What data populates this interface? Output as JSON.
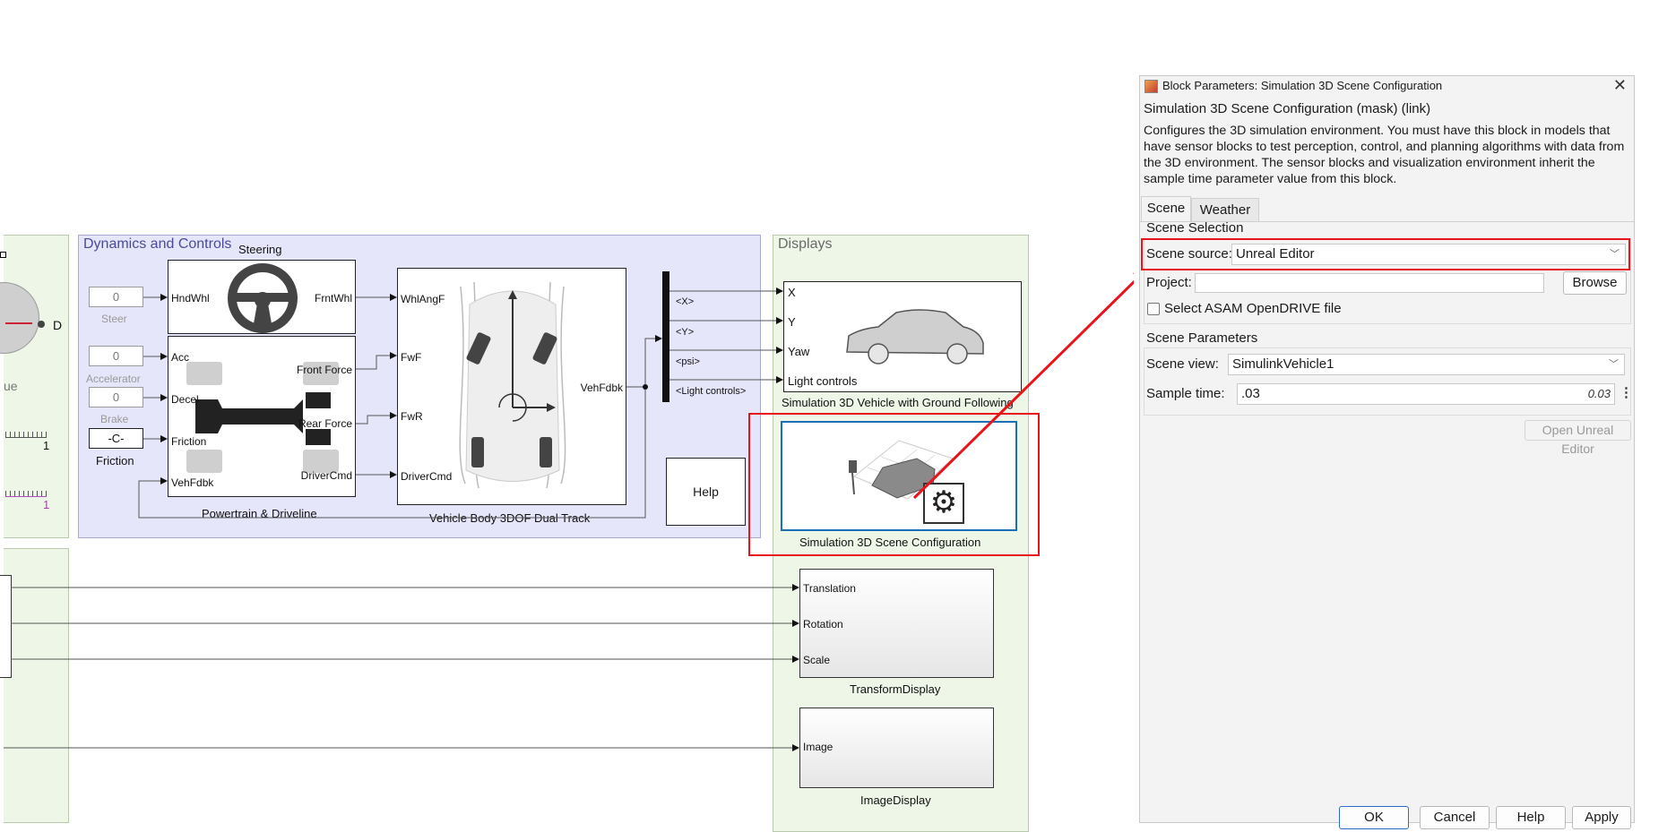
{
  "canvas": {
    "dynamics_area": {
      "title": "Dynamics and Controls"
    },
    "displays_area": {
      "title": "Displays"
    },
    "left_area": {
      "label_d": "D",
      "label_ue": "ue",
      "tick_1a": "1",
      "tick_1b": "1"
    },
    "steering": {
      "title": "Steering",
      "in_port": "HndWhl",
      "out_port": "FrntWhl"
    },
    "constants": [
      {
        "value": "0",
        "label": "Steer"
      },
      {
        "value": "0",
        "label": "Accelerator"
      },
      {
        "value": "0",
        "label": "Brake"
      },
      {
        "value": "-C-",
        "label": "Friction"
      }
    ],
    "powertrain": {
      "title": "Powertrain & Driveline",
      "in_ports": [
        "Acc",
        "Decel",
        "Friction",
        "VehFdbk"
      ],
      "out_ports": [
        "Front Force",
        "Rear Force",
        "DriverCmd"
      ]
    },
    "vehicle_body": {
      "title": "Vehicle Body 3DOF Dual Track",
      "in_ports": [
        "WhlAngF",
        "FwF",
        "FwR",
        "DriverCmd"
      ],
      "out_port": "VehFdbk"
    },
    "bus_signals": [
      "<X>",
      "<Y>",
      "<psi>",
      "<Light controls>"
    ],
    "help_block": {
      "label": "Help"
    },
    "vehicle_ground": {
      "title": "Simulation 3D Vehicle with Ground Following",
      "ports": [
        "X",
        "Y",
        "Yaw",
        "Light controls"
      ]
    },
    "scene_config": {
      "title": "Simulation 3D Scene Configuration"
    },
    "transform_display": {
      "title": "TransformDisplay",
      "ports": [
        "Translation",
        "Rotation",
        "Scale"
      ]
    },
    "image_display": {
      "title": "ImageDisplay",
      "port": "Image"
    },
    "highlight_color": "#e8141b"
  },
  "dialog": {
    "title": "Block Parameters: Simulation 3D Scene Configuration",
    "subtitle": "Simulation 3D Scene Configuration (mask) (link)",
    "description": "Configures the 3D simulation environment. You must have this block in models that have sensor blocks to test perception, control, and planning algorithms with data from the 3D environment. The sensor blocks and visualization environment inherit the sample time parameter value from this block.",
    "tabs": [
      "Scene",
      "Weather"
    ],
    "scene_selection": {
      "heading": "Scene Selection",
      "source_label": "Scene source:",
      "source_value": "Unreal Editor",
      "project_label": "Project:",
      "project_value": "",
      "browse_label": "Browse",
      "opendrive_label": "Select ASAM OpenDRIVE file",
      "opendrive_checked": false
    },
    "scene_parameters": {
      "heading": "Scene Parameters",
      "view_label": "Scene view:",
      "view_value": "SimulinkVehicle1",
      "sample_label": "Sample time:",
      "sample_value": ".03",
      "sample_eval": "0.03"
    },
    "open_editor_label": "Open Unreal Editor",
    "buttons": {
      "ok": "OK",
      "cancel": "Cancel",
      "help": "Help",
      "apply": "Apply"
    }
  }
}
